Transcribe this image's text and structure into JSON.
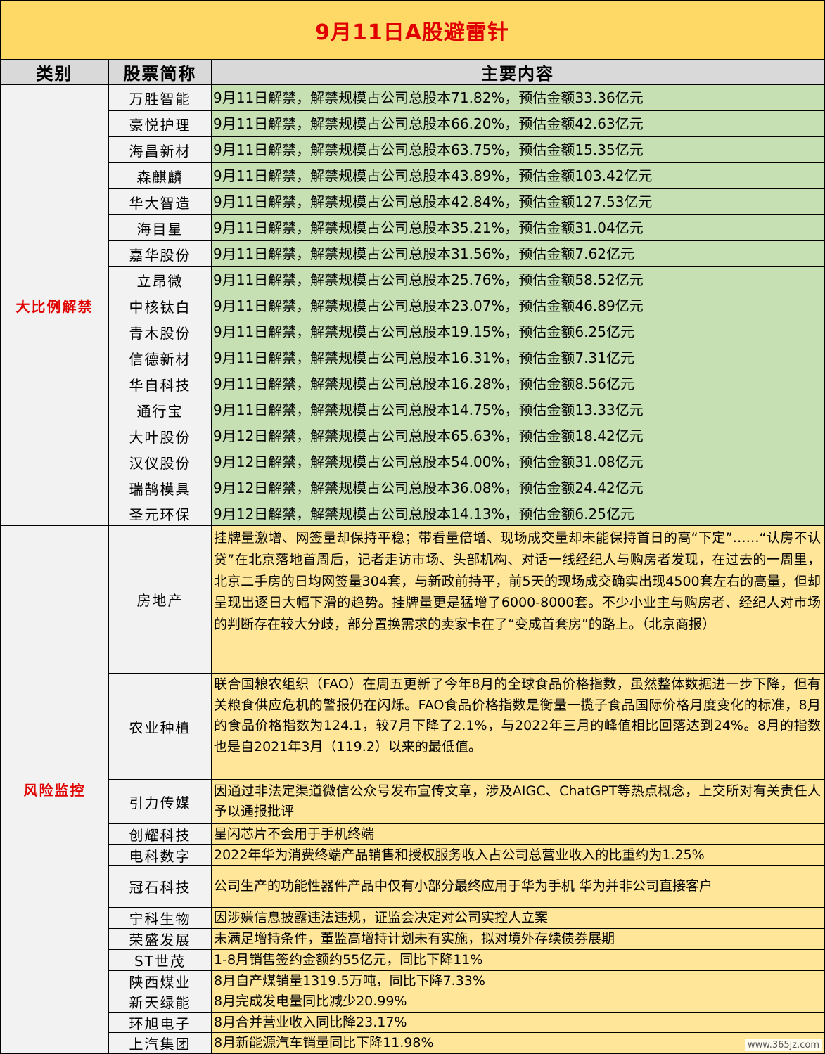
{
  "title": "9月11日A股避雷针",
  "headers": {
    "category": "类别",
    "name": "股票简称",
    "content": "主要内容"
  },
  "sections": [
    {
      "category": "大比例解禁",
      "rows": [
        {
          "name": "万胜智能",
          "content": "9月11日解禁，解禁规模占公司总股本71.82%，预估金额33.36亿元"
        },
        {
          "name": "豪悦护理",
          "content": "9月11日解禁，解禁规模占公司总股本66.20%，预估金额42.63亿元"
        },
        {
          "name": "海昌新材",
          "content": "9月11日解禁，解禁规模占公司总股本63.75%，预估金额15.35亿元"
        },
        {
          "name": "森麒麟",
          "content": "9月11日解禁，解禁规模占公司总股本43.89%，预估金额103.42亿元"
        },
        {
          "name": "华大智造",
          "content": "9月11日解禁，解禁规模占公司总股本42.84%，预估金额127.53亿元"
        },
        {
          "name": "海目星",
          "content": "9月11日解禁，解禁规模占公司总股本35.21%，预估金额31.04亿元"
        },
        {
          "name": "嘉华股份",
          "content": "9月11日解禁，解禁规模占公司总股本31.56%，预估金额7.62亿元"
        },
        {
          "name": "立昂微",
          "content": "9月11日解禁，解禁规模占公司总股本25.76%，预估金额58.52亿元"
        },
        {
          "name": "中核钛白",
          "content": "9月11日解禁，解禁规模占公司总股本23.07%，预估金额46.89亿元"
        },
        {
          "name": "青木股份",
          "content": "9月11日解禁，解禁规模占公司总股本19.15%，预估金额6.25亿元"
        },
        {
          "name": "信德新材",
          "content": "9月11日解禁，解禁规模占公司总股本16.31%，预估金额7.31亿元"
        },
        {
          "name": "华自科技",
          "content": "9月11日解禁，解禁规模占公司总股本16.28%，预估金额8.56亿元"
        },
        {
          "name": "通行宝",
          "content": "9月11日解禁，解禁规模占公司总股本14.75%，预估金额13.33亿元"
        },
        {
          "name": "大叶股份",
          "content": "9月12日解禁，解禁规模占公司总股本65.63%，预估金额18.42亿元"
        },
        {
          "name": "汉仪股份",
          "content": "9月12日解禁，解禁规模占公司总股本54.00%，预估金额31.08亿元"
        },
        {
          "name": "瑞鹄模具",
          "content": "9月12日解禁，解禁规模占公司总股本36.08%，预估金额24.42亿元"
        },
        {
          "name": "圣元环保",
          "content": "9月12日解禁，解禁规模占公司总股本14.13%，预估金额6.25亿元"
        }
      ]
    },
    {
      "category": "风险监控",
      "rows": [
        {
          "name": "房地产",
          "content": "挂牌量激增、网签量却保持平稳；带看量倍增、现场成交量却未能保持首日的高“下定”……“认房不认贷”在北京落地首周后，记者走访市场、头部机构、对话一线经纪人与购房者发现，在过去的一周里，北京二手房的日均网签量304套，与新政前持平，前5天的现场成交确实出现4500套左右的高量，但却呈现出逐日大幅下滑的趋势。挂牌量更是猛增了6000-8000套。不少小业主与购房者、经纪人对市场的判断存在较大分歧，部分置换需求的卖家卡在了“变成首套房”的路上。（北京商报）"
        },
        {
          "name": "农业种植",
          "content": "联合国粮农组织（FAO）在周五更新了今年8月的全球食品价格指数，虽然整体数据进一步下降，但有关粮食供应危机的警报仍在闪烁。FAO食品价格指数是衡量一揽子食品国际价格月度变化的标准，8月的食品价格指数为124.1，较7月下降了2.1%，与2022年三月的峰值相比回落达到24%。8月的指数也是自2021年3月（119.2）以来的最低值。"
        },
        {
          "name": "引力传媒",
          "content": "因通过非法定渠道微信公众号发布宣传文章，涉及AIGC、ChatGPT等热点概念，上交所对有关责任人予以通报批评"
        },
        {
          "name": "创耀科技",
          "content": "星闪芯片不会用于手机终端"
        },
        {
          "name": "电科数字",
          "content": "2022年华为消费终端产品销售和授权服务收入占公司总营业收入的比重约为1.25%"
        },
        {
          "name": "冠石科技",
          "content": "公司生产的功能性器件产品中仅有小部分最终应用于华为手机 华为并非公司直接客户"
        },
        {
          "name": "宁科生物",
          "content": "因涉嫌信息披露违法违规，证监会决定对公司实控人立案"
        },
        {
          "name": "荣盛发展",
          "content": "未满足增持条件，董监高增持计划未有实施，拟对境外存续债券展期"
        },
        {
          "name": "ST世茂",
          "content": "1-8月销售签约金额约55亿元，同比下降11%"
        },
        {
          "name": "陕西煤业",
          "content": "8月自产煤销量1319.5万吨，同比下降7.33%"
        },
        {
          "name": "新天绿能",
          "content": "8月完成发电量同比减少20.99%"
        },
        {
          "name": "环旭电子",
          "content": "8月合并营业收入同比降23.17%"
        },
        {
          "name": "上汽集团",
          "content": "8月新能源汽车销量同比下降11.98%"
        }
      ]
    }
  ],
  "footer_url": "www.365jz.com"
}
